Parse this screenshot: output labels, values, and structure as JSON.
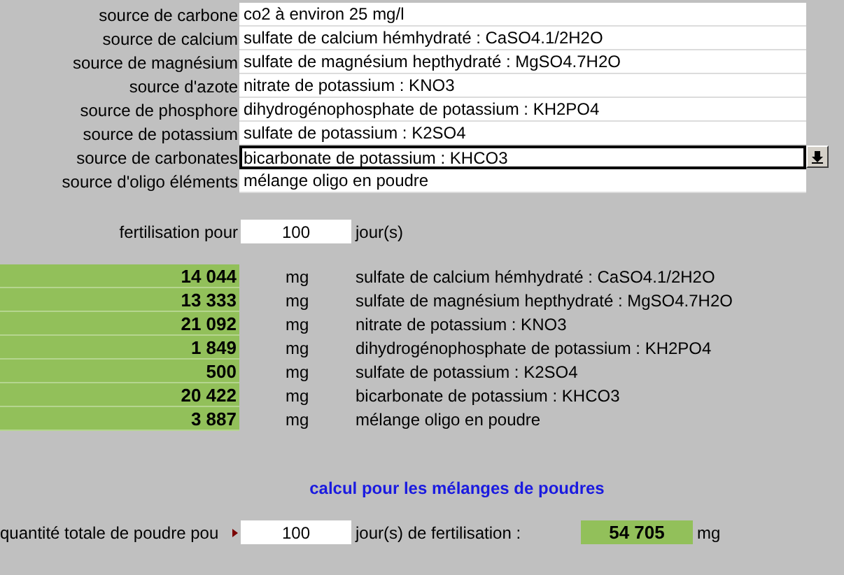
{
  "sources": [
    {
      "label": "source de carbone",
      "value": "co2 à environ 25 mg/l",
      "selected": false
    },
    {
      "label": "source de calcium",
      "value": "sulfate de calcium hémhydraté : CaSO4.1/2H2O",
      "selected": false
    },
    {
      "label": "source de magnésium",
      "value": "sulfate de magnésium hepthydraté : MgSO4.7H2O",
      "selected": false
    },
    {
      "label": "source d'azote",
      "value": "nitrate de potassium : KNO3",
      "selected": false
    },
    {
      "label": "source de phosphore",
      "value": "dihydrogénophosphate de potassium : KH2PO4",
      "selected": false
    },
    {
      "label": "source de potassium",
      "value": "sulfate de potassium : K2SO4",
      "selected": false
    },
    {
      "label": "source de carbonates",
      "value": "bicarbonate de potassium : KHCO3",
      "selected": true
    },
    {
      "label": "source d'oligo éléments",
      "value": "mélange oligo en poudre",
      "selected": false
    }
  ],
  "fertilisation": {
    "label": "fertilisation pour",
    "value": "100",
    "unit": "jour(s)"
  },
  "results": [
    {
      "amount": "14 044",
      "unit": "mg",
      "product": "sulfate de calcium hémhydraté : CaSO4.1/2H2O"
    },
    {
      "amount": "13 333",
      "unit": "mg",
      "product": "sulfate de magnésium hepthydraté : MgSO4.7H2O"
    },
    {
      "amount": "21 092",
      "unit": "mg",
      "product": "nitrate de potassium : KNO3"
    },
    {
      "amount": "1 849",
      "unit": "mg",
      "product": "dihydrogénophosphate de potassium : KH2PO4"
    },
    {
      "amount": "500",
      "unit": "mg",
      "product": "sulfate de potassium : K2SO4"
    },
    {
      "amount": "20 422",
      "unit": "mg",
      "product": "bicarbonate de potassium : KHCO3"
    },
    {
      "amount": "3 887",
      "unit": "mg",
      "product": "mélange oligo en poudre"
    }
  ],
  "section_title": "calcul pour les mélanges de poudres",
  "total": {
    "label": "quantité totale de poudre pou",
    "has_comment": true,
    "value": "100",
    "unit": "jour(s) de fertilisation :",
    "amount": "54 705",
    "amount_unit": "mg"
  }
}
